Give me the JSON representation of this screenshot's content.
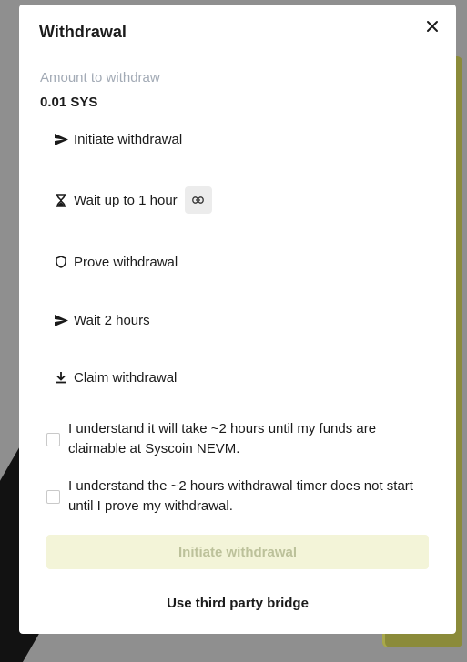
{
  "modal": {
    "title": "Withdrawal",
    "amount_label": "Amount to withdraw",
    "amount_value": "0.01 SYS"
  },
  "steps": [
    {
      "label": "Initiate withdrawal",
      "icon": "send-icon"
    },
    {
      "label": "Wait up to 1 hour",
      "icon": "hourglass-icon"
    },
    {
      "label": "Prove withdrawal",
      "icon": "shield-icon"
    },
    {
      "label": "Wait 2 hours",
      "icon": "send-icon"
    },
    {
      "label": "Claim withdrawal",
      "icon": "download-icon"
    }
  ],
  "checkboxes": [
    {
      "text": "I understand it will take ~2 hours until my funds are claimable at Syscoin NEVM.",
      "checked": false
    },
    {
      "text": "I understand the ~2 hours withdrawal timer does not start until I prove my withdrawal.",
      "checked": false
    }
  ],
  "buttons": {
    "initiate": "Initiate withdrawal",
    "third_party": "Use third party bridge"
  },
  "colors": {
    "primary_disabled_bg": "#f3f4d8",
    "primary_disabled_text": "#bcc19a",
    "muted_label": "#a2aab5"
  }
}
